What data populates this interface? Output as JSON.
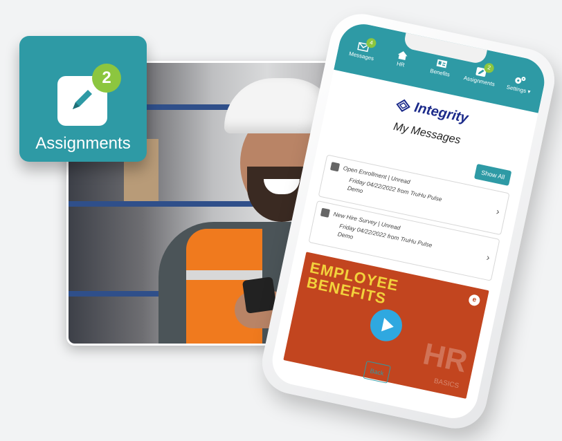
{
  "assignments_card": {
    "label": "Assignments",
    "badge": "2",
    "bg_color": "#2e9aa5",
    "badge_color": "#8cc63f"
  },
  "app": {
    "header_color": "#2e9aa5",
    "nav": [
      {
        "label": "Messages",
        "icon": "envelope-icon",
        "badge": "4"
      },
      {
        "label": "HR",
        "icon": "home-icon",
        "badge": ""
      },
      {
        "label": "Benefits",
        "icon": "id-card-icon",
        "badge": ""
      },
      {
        "label": "Assignments",
        "icon": "pencil-icon",
        "badge": "2"
      },
      {
        "label": "Settings ▾",
        "icon": "gears-icon",
        "badge": ""
      }
    ],
    "brand": "Integrity",
    "page_title": "My Messages",
    "show_all": "Show All",
    "messages": [
      {
        "title": "Open Enrollment | Unread",
        "detail": "Friday 04/22/2022 from TruHu Pulse Demo",
        "icon": "pencil-icon"
      },
      {
        "title": "New Hire Survey | Unread",
        "detail": "Friday 04/22/2022 from TruHu Pulse Demo",
        "icon": "bar-chart-icon"
      }
    ],
    "video": {
      "title_line1": "EMPLOYEE",
      "title_line2": "BENEFITS",
      "hr": "HR",
      "basics": "BASICS"
    },
    "back": "Back"
  }
}
